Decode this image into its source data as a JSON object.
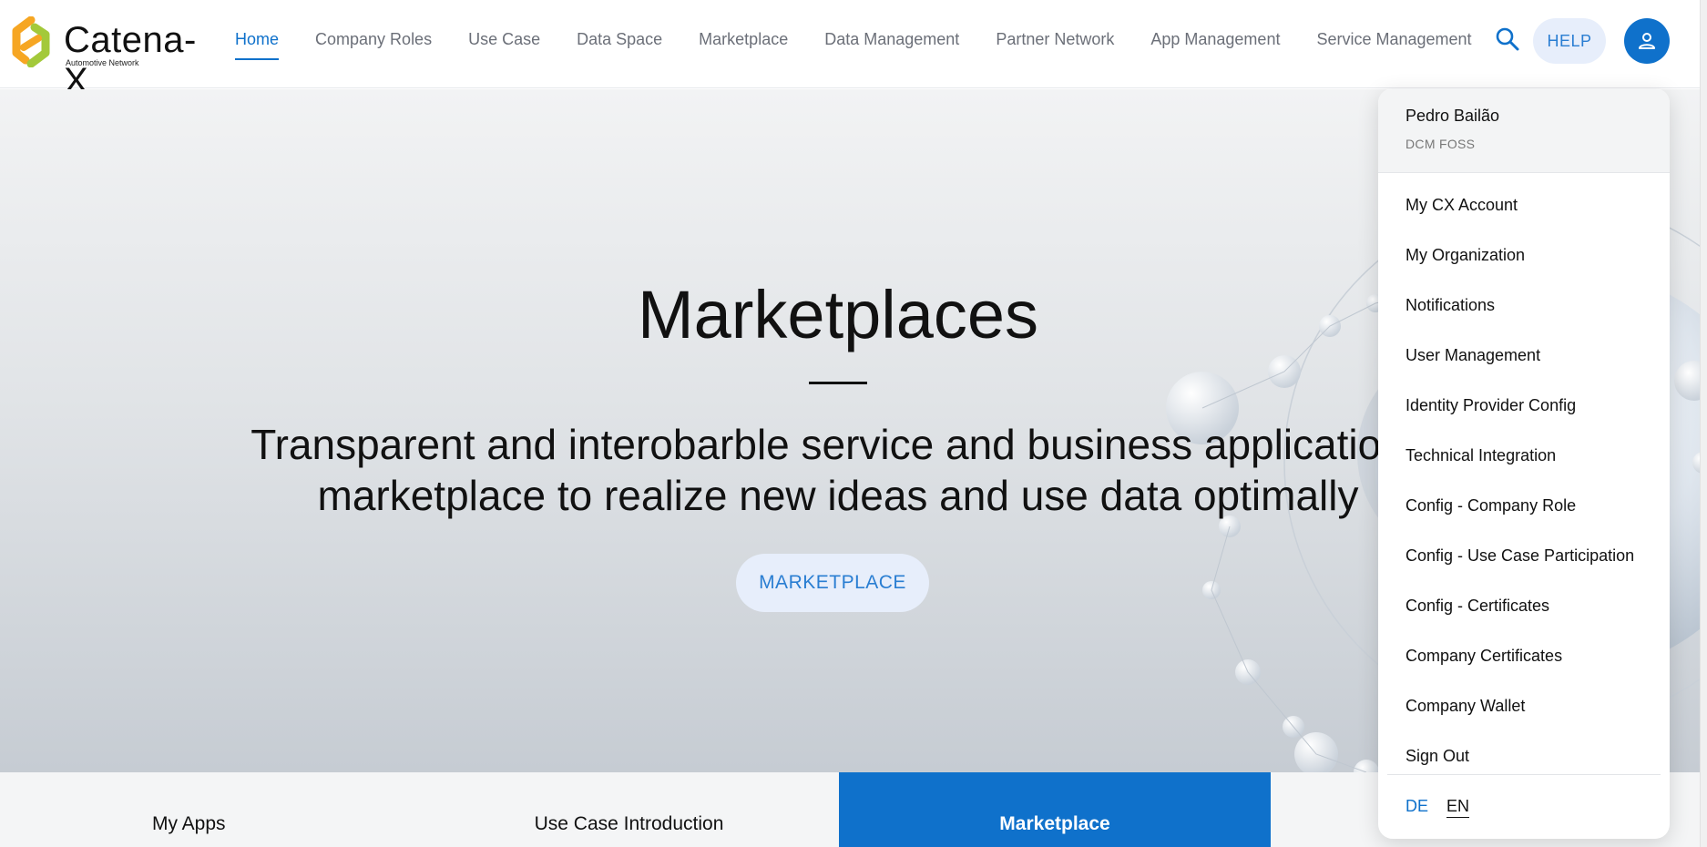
{
  "header": {
    "logo_text": "Catena-X",
    "logo_sub": "Automotive Network",
    "nav": [
      {
        "label": "Home",
        "active": true
      },
      {
        "label": "Company Roles",
        "active": false
      },
      {
        "label": "Use Case",
        "active": false
      },
      {
        "label": "Data Space",
        "active": false
      },
      {
        "label": "Marketplace",
        "active": false
      },
      {
        "label": "Data Management",
        "active": false
      },
      {
        "label": "Partner Network",
        "active": false
      },
      {
        "label": "App Management",
        "active": false
      },
      {
        "label": "Service Management",
        "active": false
      }
    ],
    "help_label": "HELP"
  },
  "hero": {
    "title": "Marketplaces",
    "subtitle_line1": "Transparent and interobarble service and business applications",
    "subtitle_line2": "marketplace to realize new ideas and use data optimally",
    "cta_label": "MARKETPLACE"
  },
  "tiles": [
    {
      "label": "My Apps",
      "active": false
    },
    {
      "label": "Use Case Introduction",
      "active": false
    },
    {
      "label": "Marketplace",
      "active": true
    }
  ],
  "user_menu": {
    "user_name": "Pedro Bailão",
    "organization": "DCM FOSS",
    "items": [
      "My CX Account",
      "My Organization",
      "Notifications",
      "User Management",
      "Identity Provider Config",
      "Technical Integration",
      "Config - Company Role",
      "Config - Use Case Participation",
      "Config - Certificates",
      "Company Certificates",
      "Company Wallet",
      "Sign Out"
    ],
    "languages": [
      "DE",
      "EN"
    ],
    "selected_language": "EN"
  },
  "colors": {
    "accent": "#0f71cb",
    "button_bg": "#e7eefb",
    "logo_orange": "#f6a623",
    "logo_green": "#a3c93a"
  }
}
